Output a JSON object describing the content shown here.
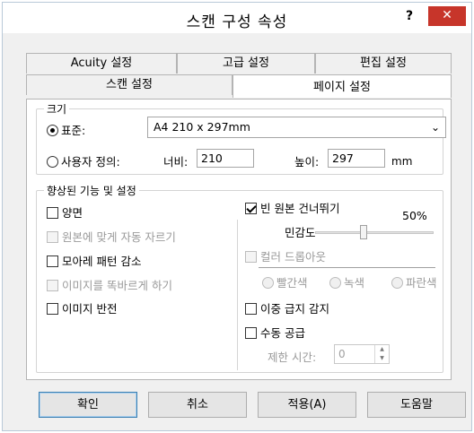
{
  "window": {
    "title": "스캔 구성 속성",
    "help_label": "?",
    "close_label": "✕"
  },
  "tabs_row1": [
    "Acuity 설정",
    "고급 설정",
    "편집 설정"
  ],
  "tabs_row2": [
    "스캔 설정",
    "페이지 설정"
  ],
  "active_tab": "페이지 설정",
  "size_group": {
    "legend": "크기",
    "standard_label": "표준:",
    "standard_selected": true,
    "paper_value": "A4 210 x 297mm",
    "custom_label": "사용자 정의:",
    "width_label": "너비:",
    "width_value": "210",
    "height_label": "높이:",
    "height_value": "297",
    "unit": "mm"
  },
  "features_group": {
    "legend": "향상된 기능 및 설정",
    "duplex": {
      "label": "양면",
      "checked": false,
      "enabled": true
    },
    "auto_crop": {
      "label": "원본에 맞게 자동 자르기",
      "checked": false,
      "enabled": false
    },
    "moire": {
      "label": "모아레 패턴 감소",
      "checked": false,
      "enabled": true
    },
    "straighten": {
      "label": "이미지를 똑바르게 하기",
      "checked": false,
      "enabled": false
    },
    "invert": {
      "label": "이미지 반전",
      "checked": false,
      "enabled": true
    },
    "skip_blank": {
      "label": "빈 원본 건너뛰기",
      "checked": true,
      "enabled": true
    },
    "sensitivity_label": "민감도",
    "sensitivity_value_label": "50%",
    "sensitivity": 0.5,
    "color_dropout": {
      "label": "컬러 드롭아웃",
      "checked": false,
      "enabled": false
    },
    "dropout_colors": [
      "빨간색",
      "녹색",
      "파란색"
    ],
    "double_feed": {
      "label": "이중 급지 감지",
      "checked": false,
      "enabled": true
    },
    "manual_feed": {
      "label": "수동 공급",
      "checked": false,
      "enabled": true
    },
    "timeout_label": "제한 시간:",
    "timeout_value": "0"
  },
  "buttons": {
    "ok": "확인",
    "cancel": "취소",
    "apply": "적용(A)",
    "help": "도움말"
  }
}
